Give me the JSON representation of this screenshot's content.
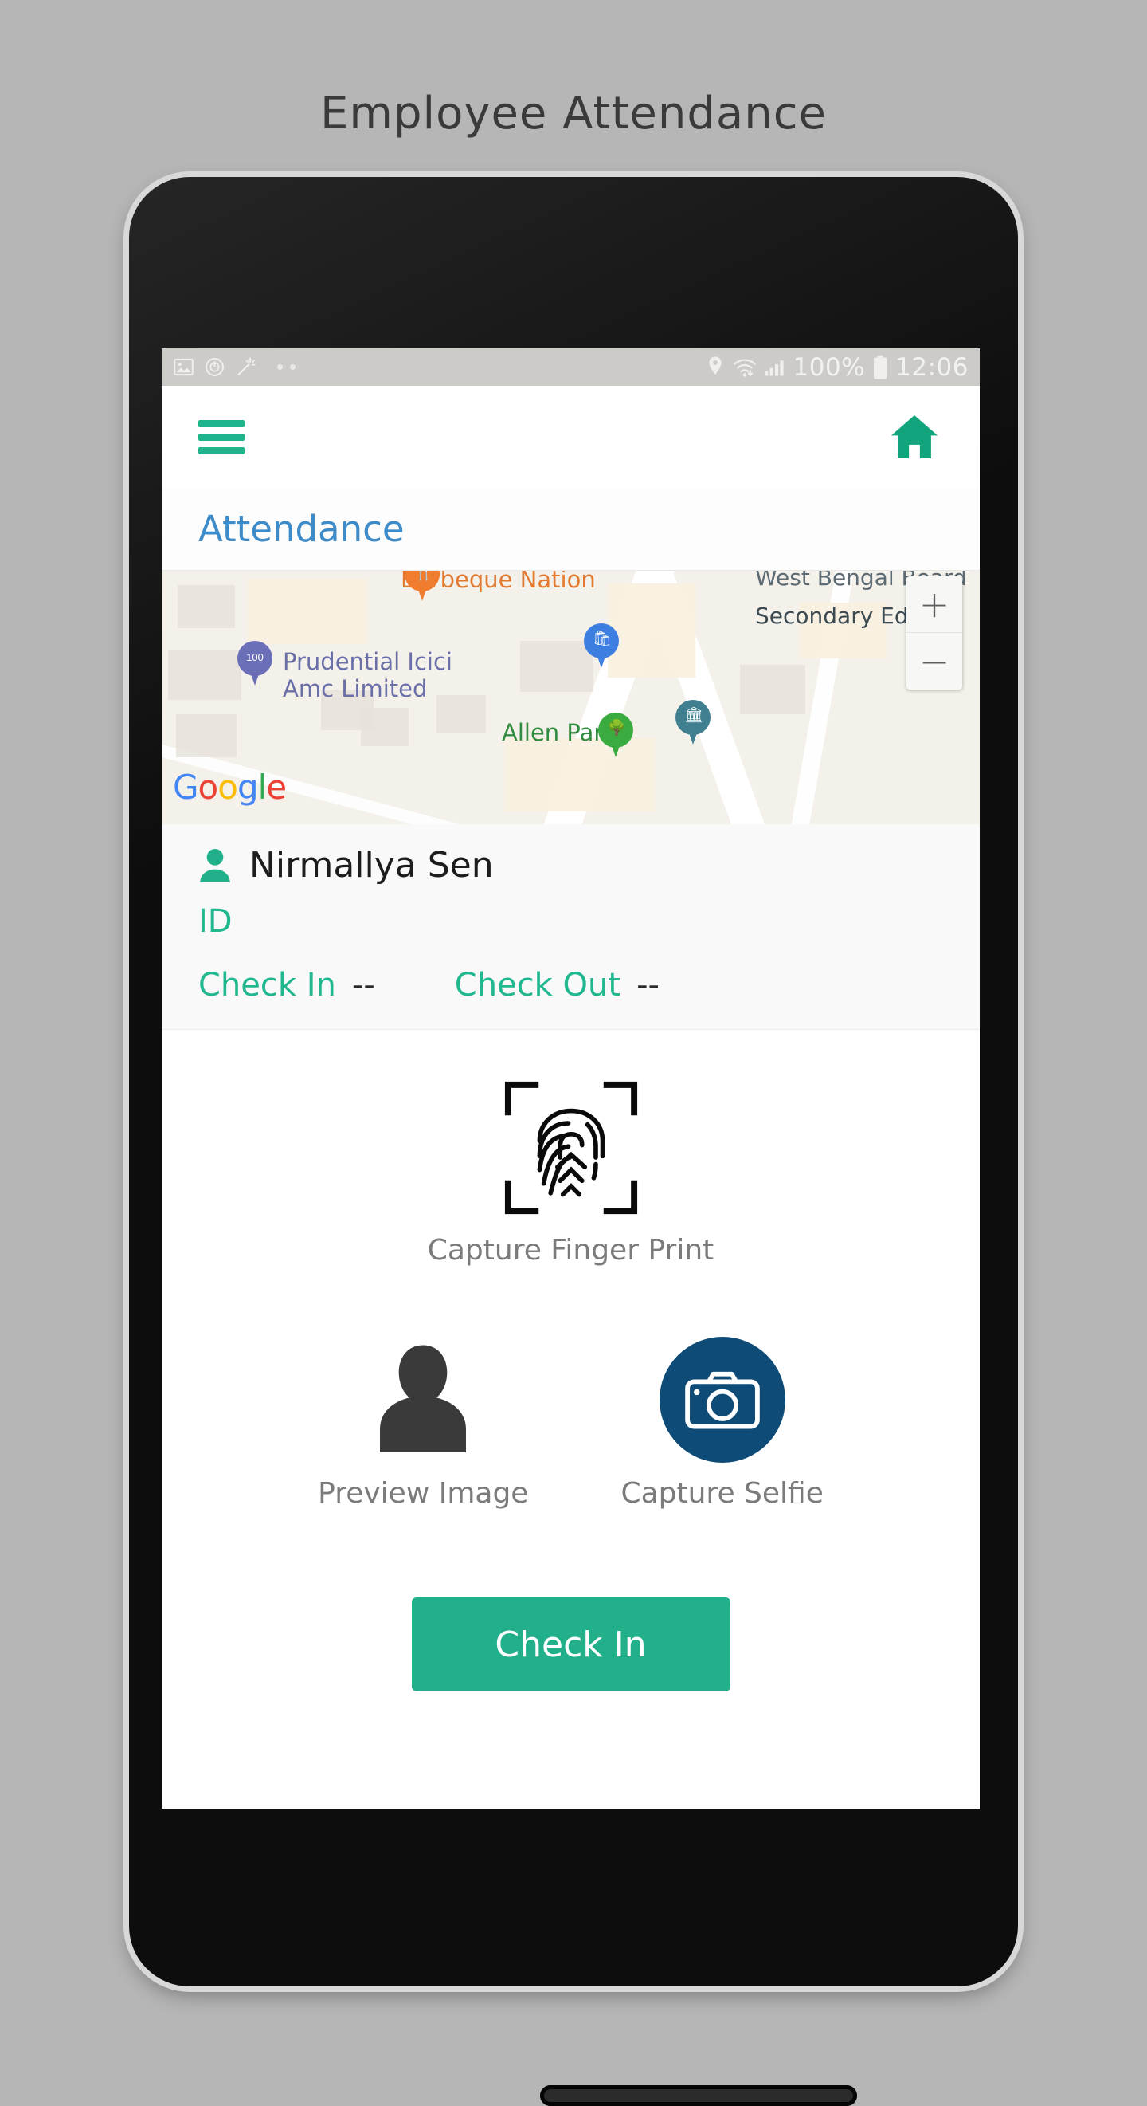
{
  "page": {
    "title": "Employee Attendance"
  },
  "statusbar": {
    "left_icons": [
      "image-icon",
      "timer-icon",
      "magic-wand-icon",
      "more-dots-icon"
    ],
    "right_icons": [
      "location-pin-icon",
      "wifi-icon",
      "signal-bars-icon",
      "battery-icon"
    ],
    "battery_percent": "100%",
    "time": "12:06"
  },
  "appbar": {
    "menu_icon": "hamburger-menu-icon",
    "home_icon": "home-icon",
    "accent_color": "#20b48d"
  },
  "subheader": {
    "title": "Attendance",
    "color": "#3d8bc9"
  },
  "map": {
    "provider_logo": "Google",
    "labels": [
      {
        "text": "Barbeque Nation",
        "color": "#e2792f"
      },
      {
        "text": "West Bengal Board",
        "color": "#5c6b74"
      },
      {
        "text": "Secondary Educati",
        "color": "#3c4a52"
      },
      {
        "text": "Prudential Icici",
        "color": "#6b6fa8"
      },
      {
        "text": "Amc Limited",
        "color": "#6b6fa8"
      },
      {
        "text": "Allen Park",
        "color": "#2f8b3e"
      }
    ],
    "markers": [
      {
        "name": "restaurant-marker",
        "glyph": "\u0007",
        "color": "#f07c30"
      },
      {
        "name": "bank-atm-marker",
        "glyph": "100",
        "color": "#6b6fb8"
      },
      {
        "name": "shopping-marker",
        "glyph": "■",
        "color": "#3d7fe0"
      },
      {
        "name": "museum-marker",
        "glyph": "▤",
        "color": "#3f7f90"
      },
      {
        "name": "park-marker",
        "glyph": "▲",
        "color": "#3aab3f"
      }
    ],
    "zoom_in_label": "+",
    "zoom_out_label": "−"
  },
  "employee": {
    "avatar_icon": "person-icon",
    "name": "Nirmallya Sen",
    "id_label": "ID",
    "id_value": "",
    "checkin_label": "Check In",
    "checkin_value": "--",
    "checkout_label": "Check Out",
    "checkout_value": "--",
    "accent_color": "#21b88f"
  },
  "actions": {
    "fingerprint_icon": "fingerprint-scan-icon",
    "fingerprint_label": "Capture Finger Print",
    "preview_icon": "person-avatar-icon",
    "preview_label": "Preview Image",
    "selfie_icon": "camera-icon",
    "selfie_label": "Capture Selfie",
    "selfie_circle_color": "#0e4c77"
  },
  "primary_button": {
    "label": "Check In",
    "color": "#22b08b"
  }
}
